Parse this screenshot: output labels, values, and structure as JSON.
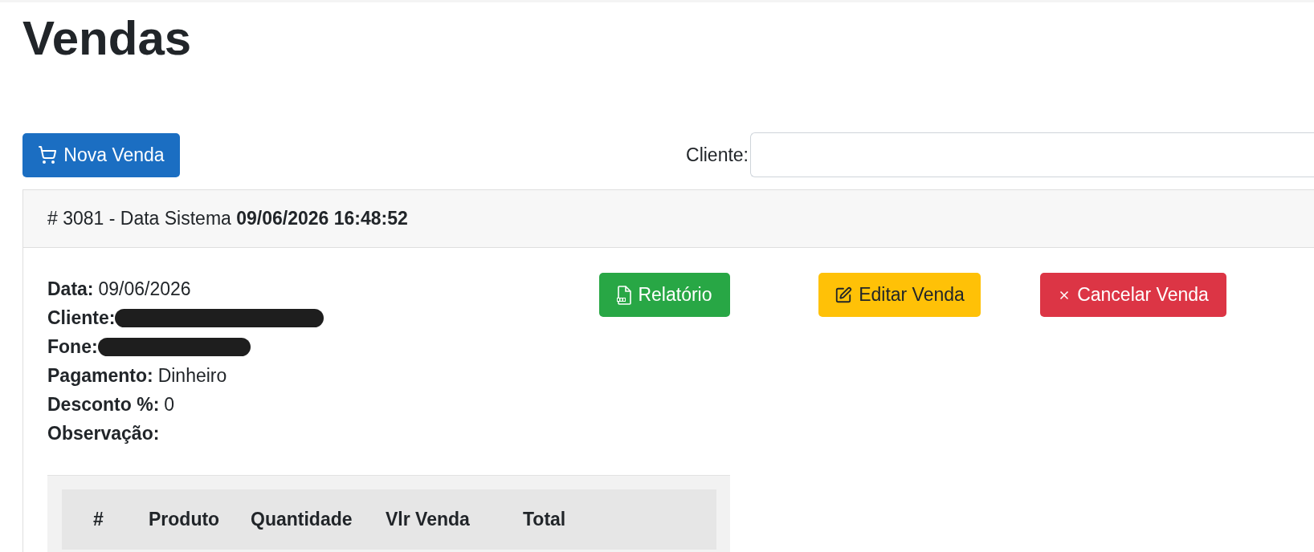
{
  "page": {
    "title": "Vendas"
  },
  "toolbar": {
    "new_sale_button": {
      "label": "Nova Venda"
    },
    "client_filter": {
      "label": "Cliente:"
    }
  },
  "sale": {
    "header": "# 3081 - Data Sistema **09/06/2026 16:48:52**",
    "details": [
      {
        "label": "Data:",
        "value": "09/06/2026"
      },
      {
        "label": "Cliente:",
        "redacted": true
      },
      {
        "label": "Fone:",
        "redacted": true
      },
      {
        "label": "Pagamento:",
        "value": "Dinheiro"
      },
      {
        "label": "Desconto %:",
        "value": "0"
      },
      {
        "label": "Observação:"
      }
    ],
    "actions": [
      {
        "kind": "report",
        "label": "Relatório"
      },
      {
        "kind": "edit",
        "label": "Editar Venda"
      },
      {
        "kind": "cancel",
        "label": "Cancelar Venda"
      }
    ],
    "items_table": {
      "columns": [
        "#",
        "Produto",
        "Quantidade",
        "Vlr Venda",
        "Total"
      ]
    }
  }
}
